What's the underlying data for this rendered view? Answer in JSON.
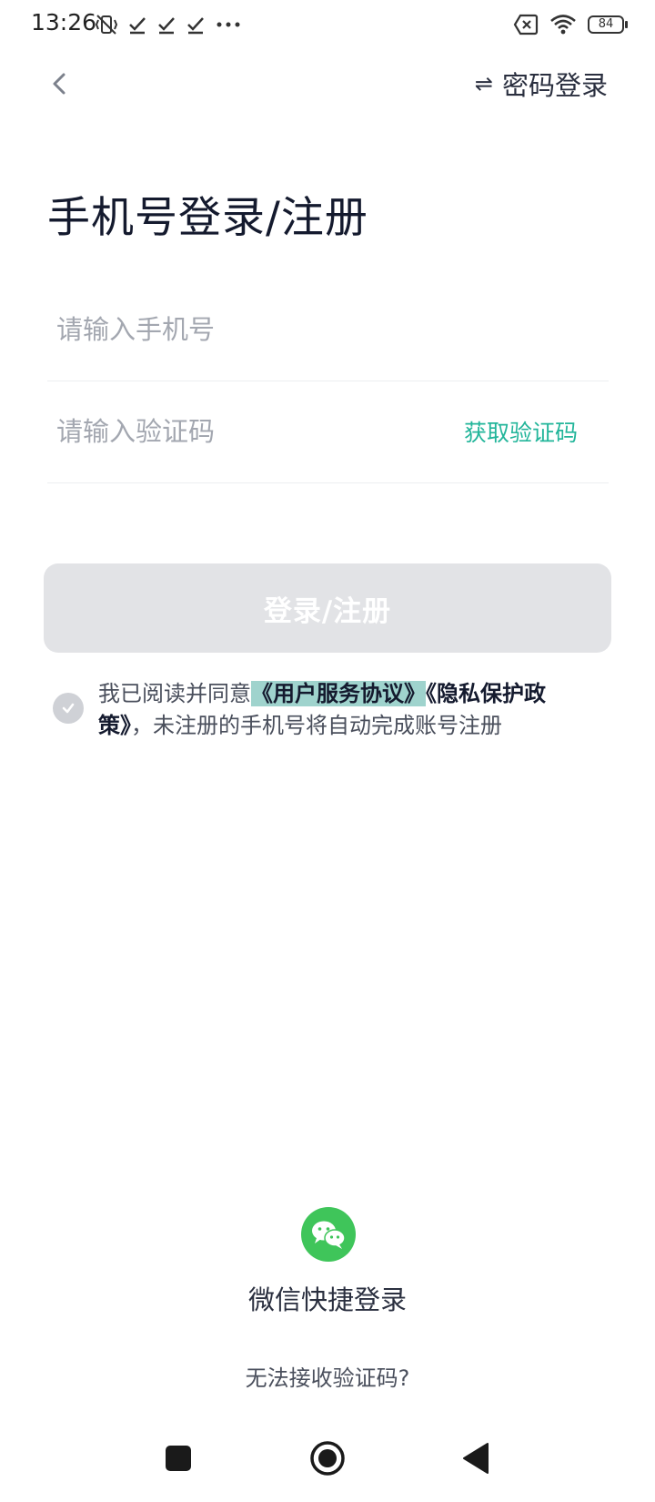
{
  "status_bar": {
    "time": "13:26",
    "left_icons": [
      "vibrate-off-icon",
      "check-icon",
      "check-icon",
      "check-icon",
      "more-dots-icon"
    ],
    "right_icons": [
      "sim-off-icon",
      "wifi-icon"
    ],
    "battery": "84"
  },
  "nav": {
    "back_icon": "chevron-left-icon",
    "switch_icon": "swap-arrows-icon",
    "switch_label": "密码登录"
  },
  "title": "手机号登录/注册",
  "form": {
    "phone_placeholder": "请输入手机号",
    "code_placeholder": "请输入验证码",
    "get_code_label": "获取验证码",
    "submit_label": "登录/注册"
  },
  "agreement": {
    "checked": true,
    "prefix": "我已阅读并同意",
    "user_agreement": "《用户服务协议》",
    "privacy_policy": "《隐私保护政策》",
    "suffix": "，未注册的手机号将自动完成账号注册"
  },
  "wechat": {
    "icon": "wechat-icon",
    "label": "微信快捷登录"
  },
  "help_label": "无法接收验证码?",
  "colors": {
    "accent": "#22b59a",
    "wechat_green": "#3fc55a",
    "button_disabled": "#e2e3e6",
    "link_highlight": "#9fd3cd"
  },
  "system_nav": [
    "recent-apps-icon",
    "home-icon",
    "back-triangle-icon"
  ]
}
